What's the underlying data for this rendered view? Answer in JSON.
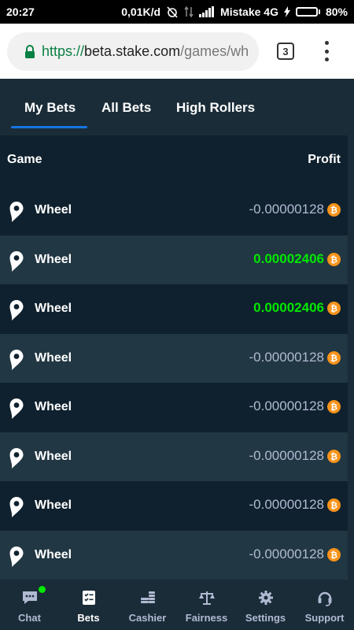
{
  "status_bar": {
    "time": "20:27",
    "net_speed": "0,01K/d",
    "carrier": "Mistake 4G",
    "battery": "80%",
    "battery_level": 0.8,
    "icons": [
      "alarm-off-icon",
      "data-arrows-icon",
      "signal-icon",
      "charging-icon",
      "battery-icon"
    ]
  },
  "browser": {
    "url_scheme": "https://",
    "url_host": "beta.stake.com",
    "url_path": "/games/wh",
    "tab_count": "3",
    "lock_color": "#0a8043"
  },
  "tabs": [
    {
      "label": "My Bets",
      "active": true
    },
    {
      "label": "All Bets",
      "active": false
    },
    {
      "label": "High Rollers",
      "active": false
    }
  ],
  "table": {
    "headers": {
      "game": "Game",
      "profit": "Profit"
    },
    "rows": [
      {
        "game": "Wheel",
        "profit": "-0.00000128",
        "positive": false
      },
      {
        "game": "Wheel",
        "profit": "0.00002406",
        "positive": true
      },
      {
        "game": "Wheel",
        "profit": "0.00002406",
        "positive": true
      },
      {
        "game": "Wheel",
        "profit": "-0.00000128",
        "positive": false
      },
      {
        "game": "Wheel",
        "profit": "-0.00000128",
        "positive": false
      },
      {
        "game": "Wheel",
        "profit": "-0.00000128",
        "positive": false
      },
      {
        "game": "Wheel",
        "profit": "-0.00000128",
        "positive": false
      },
      {
        "game": "Wheel",
        "profit": "-0.00000128",
        "positive": false
      }
    ],
    "game_icon": "wheel-pin-icon",
    "currency_icon": "bitcoin-icon"
  },
  "bottom_nav": [
    {
      "label": "Chat",
      "icon": "chat-icon",
      "active": false,
      "notification": true
    },
    {
      "label": "Bets",
      "icon": "bets-icon",
      "active": true
    },
    {
      "label": "Cashier",
      "icon": "coins-icon",
      "active": false
    },
    {
      "label": "Fairness",
      "icon": "scales-icon",
      "active": false
    },
    {
      "label": "Settings",
      "icon": "gear-icon",
      "active": false
    },
    {
      "label": "Support",
      "icon": "headset-icon",
      "active": false
    }
  ],
  "colors": {
    "background": "#1a2c38",
    "row_dark": "#0f212e",
    "row_light": "#213743",
    "accent": "#1475e1",
    "positive": "#00e701",
    "neutral_text": "#b1bad3",
    "bitcoin": "#f7931a"
  }
}
